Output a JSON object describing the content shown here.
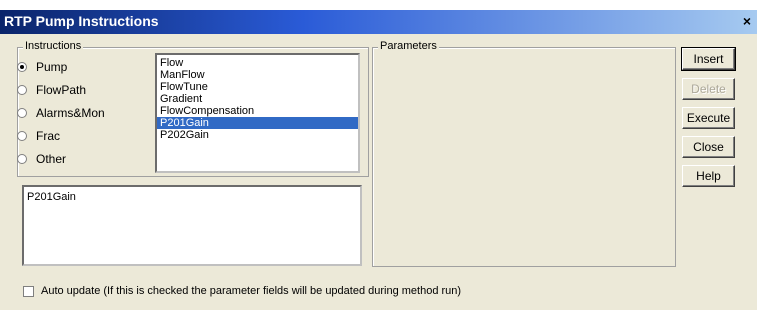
{
  "window": {
    "title": "RTP Pump Instructions",
    "close_glyph": "×"
  },
  "instructions": {
    "legend": "Instructions",
    "radios": [
      {
        "label": "Pump",
        "selected": true
      },
      {
        "label": "FlowPath",
        "selected": false
      },
      {
        "label": "Alarms&Mon",
        "selected": false
      },
      {
        "label": "Frac",
        "selected": false
      },
      {
        "label": "Other",
        "selected": false
      }
    ],
    "list_items": [
      "Flow",
      "ManFlow",
      "FlowTune",
      "Gradient",
      "FlowCompensation",
      "P201Gain",
      "P202Gain"
    ],
    "selected_item": "P201Gain"
  },
  "editor": {
    "text": "P201Gain"
  },
  "parameters": {
    "legend": "Parameters"
  },
  "buttons": {
    "insert": "Insert",
    "delete": "Delete",
    "execute": "Execute",
    "close": "Close",
    "help": "Help"
  },
  "auto_update": {
    "label": "Auto update (If this is checked the parameter fields will be updated during method run)",
    "checked": false
  }
}
